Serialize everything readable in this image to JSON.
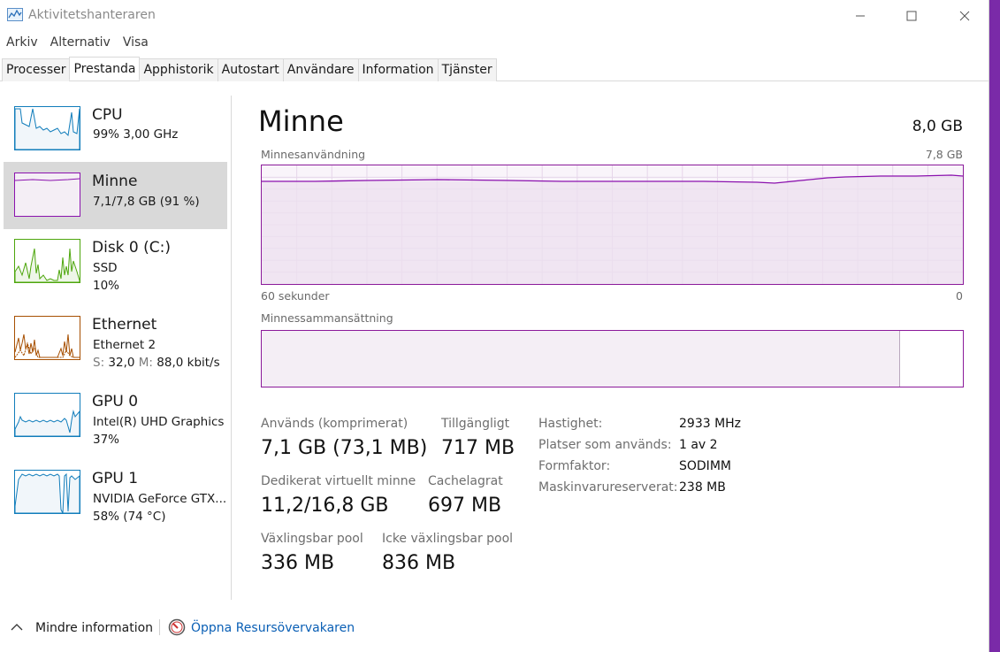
{
  "window": {
    "title": "Aktivitetshanteraren",
    "buttons": [
      "minimize",
      "maximize",
      "close"
    ]
  },
  "menu": [
    "Arkiv",
    "Alternativ",
    "Visa"
  ],
  "tabs": [
    {
      "label": "Processer",
      "active": false
    },
    {
      "label": "Prestanda",
      "active": true
    },
    {
      "label": "Apphistorik",
      "active": false
    },
    {
      "label": "Autostart",
      "active": false
    },
    {
      "label": "Användare",
      "active": false
    },
    {
      "label": "Information",
      "active": false
    },
    {
      "label": "Tjänster",
      "active": false
    }
  ],
  "sidebar": [
    {
      "title": "CPU",
      "lines": [
        "99%  3,00 GHz"
      ],
      "color": "#117dbb"
    },
    {
      "title": "Minne",
      "lines": [
        "7,1/7,8 GB (91 %)"
      ],
      "color": "#8b12ae",
      "selected": true
    },
    {
      "title": "Disk 0 (C:)",
      "lines": [
        "SSD",
        "10%"
      ],
      "color": "#4da60c"
    },
    {
      "title": "Ethernet",
      "lines": [
        "Ethernet 2"
      ],
      "send_label": "S:",
      "send_value": "32,0",
      "recv_label": "M:",
      "recv_value": "88,0 kbit/s",
      "color": "#a74f01"
    },
    {
      "title": "GPU 0",
      "lines": [
        "Intel(R) UHD Graphics",
        "37%"
      ],
      "color": "#117dbb"
    },
    {
      "title": "GPU 1",
      "lines": [
        "NVIDIA GeForce GTX...",
        "58%  (74 °C)"
      ],
      "color": "#117dbb"
    }
  ],
  "main": {
    "title": "Minne",
    "total": "8,0 GB",
    "usage_label": "Minnesanvändning",
    "usage_max": "7,8 GB",
    "time_left": "60 sekunder",
    "time_right": "0",
    "composition_label": "Minnessammansättning",
    "composition_used_fraction": 0.91
  },
  "stats": {
    "in_use_label": "Används (komprimerat)",
    "in_use_value": "7,1 GB (73,1 MB)",
    "available_label": "Tillgängligt",
    "available_value": "717 MB",
    "committed_label": "Dedikerat virtuellt minne",
    "committed_value": "11,2/16,8 GB",
    "cached_label": "Cachelagrat",
    "cached_value": "697 MB",
    "paged_label": "Växlingsbar pool",
    "paged_value": "336 MB",
    "nonpaged_label": "Icke växlingsbar pool",
    "nonpaged_value": "836 MB"
  },
  "details": [
    {
      "label": "Hastighet:",
      "value": "2933 MHz"
    },
    {
      "label": "Platser som används:",
      "value": "1 av 2"
    },
    {
      "label": "Formfaktor:",
      "value": "SODIMM"
    },
    {
      "label": "Maskinvarureserverat:",
      "value": "238 MB"
    }
  ],
  "footer": {
    "less_info": "Mindre information",
    "open_resmon": "Öppna Resursövervakaren"
  }
}
